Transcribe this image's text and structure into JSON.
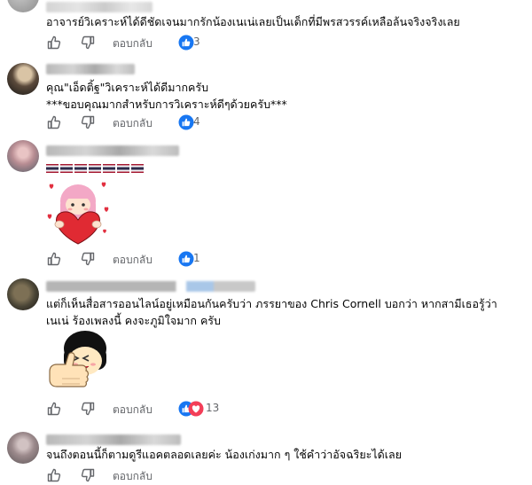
{
  "comments": [
    {
      "text": [
        "อาจารย์วิเคราะห์ได้ดีชัดเจนมากรักน้องเนเน่เลยเป็นเด็กที่มีพรสวรรค์เหลือล้นจริงจริงเลย"
      ],
      "reply_label": "ตอบกลับ",
      "reaction_count": "3"
    },
    {
      "text": [
        "คุณ\"เอ็ดติ้ฐ\"วิเคราะห์ได้ดีมากครับ",
        "***ขอบคุณมากสำหรับการวิเคราะห์ดีๆด้วยครับ***"
      ],
      "reply_label": "ตอบกลับ",
      "reaction_count": "4"
    },
    {
      "text": [],
      "reply_label": "ตอบกลับ",
      "reaction_count": "1",
      "flag_count": 7,
      "sticker": "heart-hug-sticker"
    },
    {
      "text": [
        "แต่ก็เห็นสื่อสารออนไลน์อยู่เหมือนกันครับว่า ภรรยาของ Chris Cornell บอกว่า หากสามีเธอรู้ว่า",
        "เนเน่ ร้องเพลงนี้ คงจะภูมิใจมาก ครับ"
      ],
      "reply_label": "ตอบกลับ",
      "reaction_count": "13",
      "sticker": "thumbs-up-sticker"
    },
    {
      "text": [
        "จนถึงตอนนี้ก็ตามดูรีแอคตลอดเลยค่ะ น้องเก่งมาก ๆ ใช้คำว่าอัจฉริยะได้เลย"
      ],
      "reply_label": "ตอบกลับ"
    }
  ],
  "colors": {
    "like_blue": "#1877f2",
    "love_red": "#f33e58",
    "meta_gray": "#65676b"
  }
}
